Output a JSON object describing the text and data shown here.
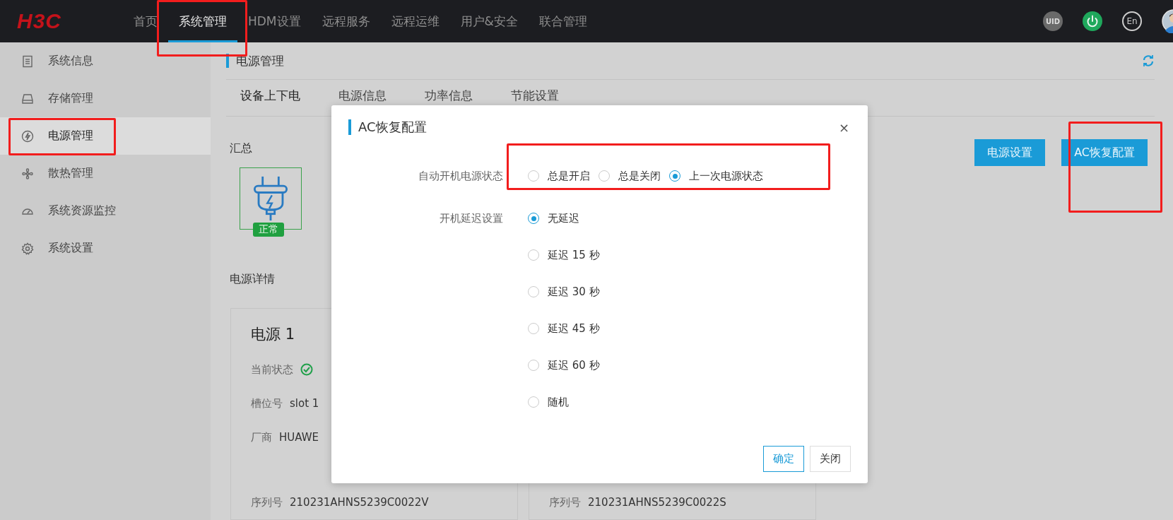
{
  "top_bar": {
    "logo": "H3C",
    "nav": [
      {
        "label": "首页",
        "selected": false
      },
      {
        "label": "系统管理",
        "selected": true
      },
      {
        "label": "HDM设置",
        "selected": false
      },
      {
        "label": "远程服务",
        "selected": false
      },
      {
        "label": "远程运维",
        "selected": false
      },
      {
        "label": "用户&安全",
        "selected": false
      },
      {
        "label": "联合管理",
        "selected": false
      }
    ],
    "uid_label": "UID",
    "language_label": "En"
  },
  "sidebar": {
    "items": [
      {
        "label": "系统信息",
        "kind": "document",
        "selected": false
      },
      {
        "label": "存储管理",
        "kind": "disk",
        "selected": false
      },
      {
        "label": "电源管理",
        "kind": "power",
        "selected": true
      },
      {
        "label": "散热管理",
        "kind": "fan",
        "selected": false
      },
      {
        "label": "系统资源监控",
        "kind": "gauge",
        "selected": false
      },
      {
        "label": "系统设置",
        "kind": "gear",
        "selected": false
      }
    ]
  },
  "page": {
    "title": "电源管理",
    "tabs": [
      {
        "label": "设备上下电",
        "selected": true
      },
      {
        "label": "电源信息",
        "selected": false
      },
      {
        "label": "功率信息",
        "selected": false
      },
      {
        "label": "节能设置",
        "selected": false
      }
    ],
    "summary_title": "汇总",
    "summary_badge": "正常",
    "buttons": [
      "电源设置",
      "AC恢复配置"
    ],
    "details_title": "电源详情",
    "cards": [
      {
        "title": "电源 1",
        "fields": [
          {
            "label": "当前状态",
            "kind": "status"
          },
          {
            "label": "槽位号",
            "value": "slot 1"
          },
          {
            "label": "厂商",
            "value": "HUAWE"
          },
          {
            "label": "序列号",
            "value": "210231AHNS5239C0022V"
          }
        ]
      },
      {
        "fields": [
          {
            "label": "序列号",
            "value": "210231AHNS5239C0022S"
          }
        ]
      }
    ]
  },
  "dialog": {
    "title": "AC恢复配置",
    "close": "×",
    "fields": [
      {
        "label": "自动开机电源状态",
        "kind": "inline",
        "options": [
          {
            "label": "总是开启",
            "selected": false
          },
          {
            "label": "总是关闭",
            "selected": false
          },
          {
            "label": "上一次电源状态",
            "selected": true
          }
        ]
      },
      {
        "label": "开机延迟设置",
        "kind": "stacked",
        "options": [
          {
            "label": "无延迟",
            "selected": true
          },
          {
            "label": "延迟 15 秒",
            "selected": false
          },
          {
            "label": "延迟 30 秒",
            "selected": false
          },
          {
            "label": "延迟 45 秒",
            "selected": false
          },
          {
            "label": "延迟 60 秒",
            "selected": false
          },
          {
            "label": "随机",
            "selected": false
          }
        ]
      }
    ],
    "buttons": [
      "确定",
      "关闭"
    ]
  }
}
